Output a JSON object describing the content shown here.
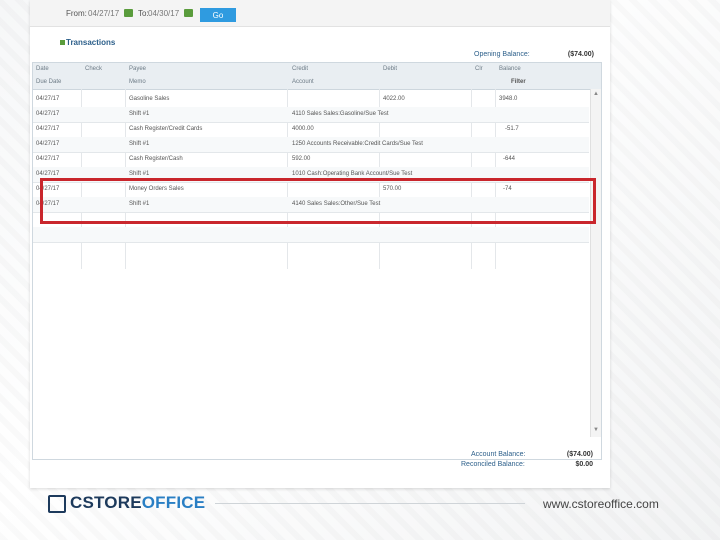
{
  "filter_bar": {
    "from_label": "From:",
    "from_date": "04/27/17",
    "to_label": "To:",
    "to_date": "04/30/17",
    "go_label": "Go"
  },
  "transactions": {
    "title": "Transactions",
    "opening_balance_label": "Opening Balance:",
    "opening_balance_value": "($74.00)"
  },
  "table": {
    "header_top": [
      "Date",
      "Check",
      "Payee",
      "Credit",
      "Debit",
      "Clr",
      "Balance"
    ],
    "header_bottom": [
      "Due Date",
      "",
      "Memo",
      "Account",
      "",
      "",
      "Filter"
    ],
    "rows": [
      {
        "date": "04/27/17",
        "check": "",
        "payee": "Gasoline Sales",
        "credit": "",
        "debit": "4022.00",
        "clr": "",
        "balance": "3948.0"
      },
      {
        "date": "04/27/17",
        "check": "",
        "payee": "Shift #1",
        "credit": "4110 Sales Sales:Gasoline/Sue Test",
        "debit": "",
        "clr": "",
        "balance": ""
      },
      {
        "date": "04/27/17",
        "check": "",
        "payee": "Cash Register/Credit Cards",
        "credit": "4000.00",
        "debit": "",
        "clr": "",
        "balance": "-51.7"
      },
      {
        "date": "04/27/17",
        "check": "",
        "payee": "Shift #1",
        "credit": "1250 Accounts Receivable:Credit Cards/Sue Test",
        "debit": "",
        "clr": "",
        "balance": ""
      },
      {
        "date": "04/27/17",
        "check": "",
        "payee": "Cash Register/Cash",
        "credit": "592.00",
        "debit": "",
        "clr": "",
        "balance": "-644"
      },
      {
        "date": "04/27/17",
        "check": "",
        "payee": "Shift #1",
        "credit": "1010 Cash:Operating Bank Account/Sue Test",
        "debit": "",
        "clr": "",
        "balance": ""
      },
      {
        "date": "04/27/17",
        "check": "",
        "payee": "Money Orders Sales",
        "credit": "",
        "debit": "570.00",
        "clr": "",
        "balance": "-74"
      },
      {
        "date": "04/27/17",
        "check": "",
        "payee": "Shift #1",
        "credit": "4140 Sales Sales:Other/Sue Test",
        "debit": "",
        "clr": "",
        "balance": ""
      }
    ]
  },
  "summary": {
    "account_balance_label": "Account Balance:",
    "account_balance_value": "($74.00)",
    "reconciled_balance_label": "Reconciled Balance:",
    "reconciled_balance_value": "$0.00"
  },
  "footer": {
    "logo_part1": "CSTORE",
    "logo_part2": "OFFICE",
    "url": "www.cstoreoffice.com"
  },
  "colors": {
    "highlight": "#c9262c",
    "header_blue": "#2c5f8a",
    "go_button": "#2f9be0"
  }
}
